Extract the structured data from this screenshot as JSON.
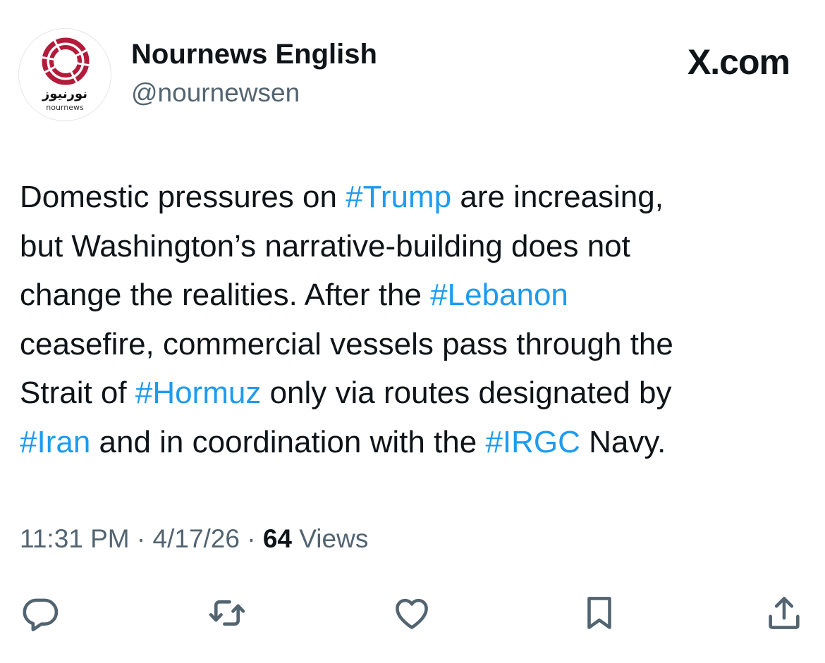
{
  "header": {
    "display_name": "Nournews English",
    "handle": "@nournewsen",
    "watermark": "X.com"
  },
  "avatar": {
    "brand_persian": "نورنیوز",
    "brand_latin": "nournews",
    "brand_color": "#b31b3a"
  },
  "tweet": {
    "lines": [
      {
        "a": "Domestic pressures on ",
        "tag": "#Trump",
        "b": " are increasing,"
      },
      {
        "a": "but Washington’s narrative-building does not"
      },
      {
        "a": "change the realities. After the ",
        "tag": "#Lebanon"
      },
      {
        "a": "ceasefire, commercial vessels pass through the"
      },
      {
        "a": "Strait of ",
        "tag": "#Hormuz",
        "b": " only via routes designated by"
      },
      {
        "tag": "#Iran",
        "b": " and in coordination with the ",
        "tag2": "#IRGC",
        "c": " Navy."
      }
    ]
  },
  "meta": {
    "time": "11:31 PM",
    "separator": " · ",
    "date": "4/17/26",
    "views_count": "64",
    "views_label": " Views"
  },
  "actions": {
    "icons": [
      "reply-icon",
      "retweet-icon",
      "like-icon",
      "bookmark-icon",
      "share-icon"
    ]
  },
  "colors": {
    "text": "#0f1419",
    "secondary": "#536471",
    "link": "#1d9bf0"
  }
}
